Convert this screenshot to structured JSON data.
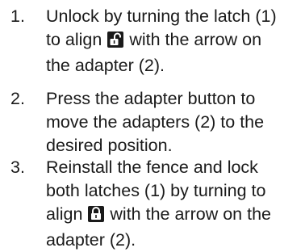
{
  "steps": [
    {
      "number": "1.",
      "lines": [
        [
          "Unlock by turning the latch (1)"
        ],
        [
          "to align",
          "with the arrow on"
        ],
        [
          "the adapter (2)."
        ]
      ],
      "icon": "unlocked-padlock-icon"
    },
    {
      "number": "2.",
      "lines": [
        [
          "Press the adapter button to"
        ],
        [
          "move the adapters (2) to the"
        ],
        [
          "desired position."
        ]
      ]
    },
    {
      "number": "3.",
      "lines": [
        [
          "Reinstall the fence and lock"
        ],
        [
          "both latches (1) by turning to"
        ],
        [
          "align",
          "with the arrow on the"
        ],
        [
          "adapter (2)."
        ]
      ],
      "icon": "locked-padlock-icon"
    }
  ]
}
